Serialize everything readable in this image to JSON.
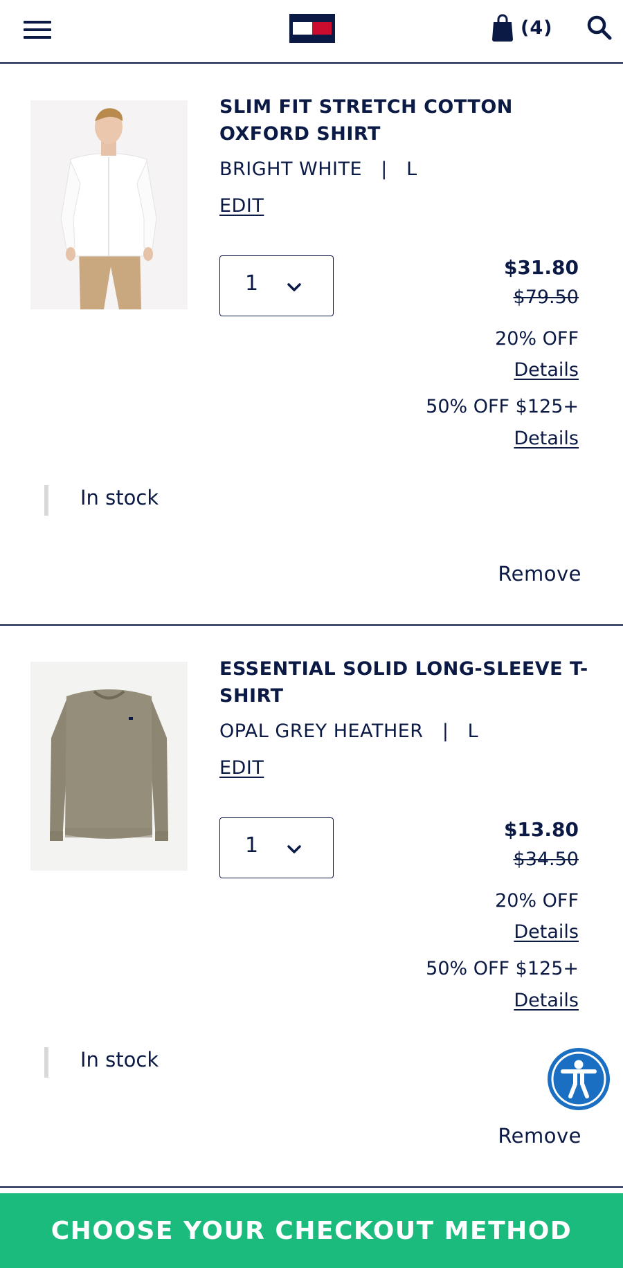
{
  "header": {
    "cart_count": "(4)",
    "icons": {
      "menu": "hamburger-menu-icon",
      "logo": "brand-flag-logo",
      "bag": "shopping-bag-icon",
      "search": "search-icon"
    },
    "colors": {
      "navy": "#0b1a45",
      "red": "#cc0c2f",
      "white": "#ffffff"
    }
  },
  "cart_items": [
    {
      "name": "SLIM FIT STRETCH COTTON OXFORD SHIRT",
      "variant": "BRIGHT WHITE   |   L",
      "edit_label": "EDIT",
      "quantity": "1",
      "sale_price": "$31.80",
      "original_price": "$79.50",
      "promo_1": "20% OFF",
      "promo_1_details": "Details",
      "promo_2": "50% OFF $125+",
      "promo_2_details": "Details",
      "stock_status": "In stock",
      "remove_label": "Remove"
    },
    {
      "name": "ESSENTIAL SOLID LONG-SLEEVE T-SHIRT",
      "variant": "OPAL GREY HEATHER   |   L",
      "edit_label": "EDIT",
      "quantity": "1",
      "sale_price": "$13.80",
      "original_price": "$34.50",
      "promo_1": "20% OFF",
      "promo_1_details": "Details",
      "promo_2": "50% OFF $125+",
      "promo_2_details": "Details",
      "stock_status": "In stock",
      "remove_label": "Remove"
    }
  ],
  "checkout": {
    "label": "CHOOSE YOUR CHECKOUT METHOD",
    "color": "#1bbb7d"
  },
  "accessibility_widget": {
    "icon": "accessibility-person-icon",
    "color": "#1a6fc2"
  }
}
